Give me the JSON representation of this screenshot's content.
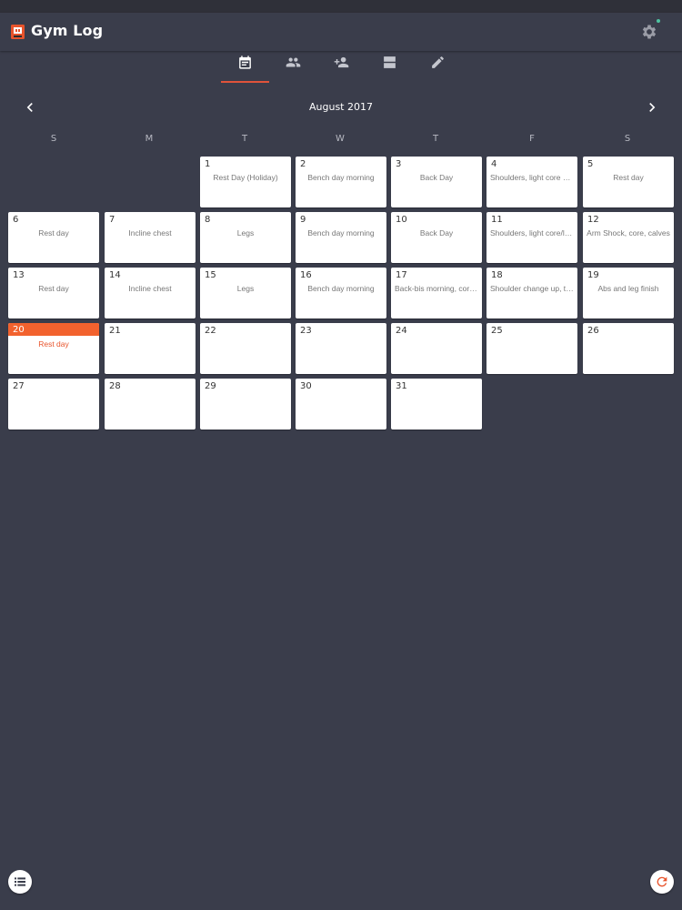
{
  "app": {
    "title": "Gym Log"
  },
  "tabs": [
    {
      "icon": "calendar-icon",
      "active": true
    },
    {
      "icon": "people-icon",
      "active": false
    },
    {
      "icon": "person-add-icon",
      "active": false
    },
    {
      "icon": "view-agenda-icon",
      "active": false
    },
    {
      "icon": "pencil-icon",
      "active": false
    }
  ],
  "calendar": {
    "month_label": "August 2017",
    "weekdays": [
      "S",
      "M",
      "T",
      "W",
      "T",
      "F",
      "S"
    ],
    "today": 20,
    "days": [
      {
        "num": "1",
        "note": "Rest Day (Holiday)"
      },
      {
        "num": "2",
        "note": "Bench day morning"
      },
      {
        "num": "3",
        "note": "Back Day"
      },
      {
        "num": "4",
        "note": "Shoulders, light core a…"
      },
      {
        "num": "5",
        "note": "Rest day"
      },
      {
        "num": "6",
        "note": "Rest day"
      },
      {
        "num": "7",
        "note": "Incline chest"
      },
      {
        "num": "8",
        "note": "Legs"
      },
      {
        "num": "9",
        "note": "Bench day morning"
      },
      {
        "num": "10",
        "note": "Back Day"
      },
      {
        "num": "11",
        "note": "Shoulders, light core/le…"
      },
      {
        "num": "12",
        "note": "Arm Shock, core, calves"
      },
      {
        "num": "13",
        "note": "Rest day"
      },
      {
        "num": "14",
        "note": "Incline chest"
      },
      {
        "num": "15",
        "note": "Legs"
      },
      {
        "num": "16",
        "note": "Bench day morning"
      },
      {
        "num": "17",
        "note": "Back-bis morning, core…"
      },
      {
        "num": "18",
        "note": "Shoulder change up, tri…"
      },
      {
        "num": "19",
        "note": "Abs and leg finish"
      },
      {
        "num": "20",
        "note": "Rest day"
      },
      {
        "num": "21",
        "note": ""
      },
      {
        "num": "22",
        "note": ""
      },
      {
        "num": "23",
        "note": ""
      },
      {
        "num": "24",
        "note": ""
      },
      {
        "num": "25",
        "note": ""
      },
      {
        "num": "26",
        "note": ""
      },
      {
        "num": "27",
        "note": ""
      },
      {
        "num": "28",
        "note": ""
      },
      {
        "num": "29",
        "note": ""
      },
      {
        "num": "30",
        "note": ""
      },
      {
        "num": "31",
        "note": ""
      }
    ]
  },
  "colors": {
    "background": "#3a3d4b",
    "accent": "#e0533a",
    "today": "#f2622e"
  }
}
